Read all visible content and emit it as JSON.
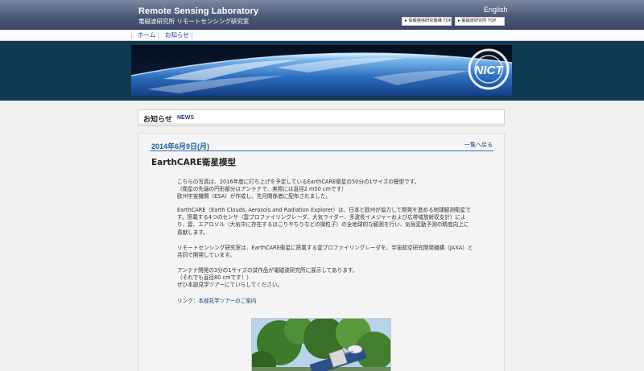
{
  "header": {
    "title": "Remote Sensing Laboratory",
    "subtitle": "電磁波研究所 リモートセンシング研究室",
    "language_link": "English",
    "buttons": [
      "▸ 情報通信研究機構 TOP",
      "▸ 電磁波研究所 TOP"
    ]
  },
  "nav": {
    "items": [
      "ホーム",
      "お知らせ"
    ]
  },
  "banner": {
    "logo_text": "NICT"
  },
  "section": {
    "title": "お知らせ",
    "subtitle": "NEWS"
  },
  "article": {
    "date": "2014年6月9日(月)",
    "back_link": "一覧へ戻る",
    "title": "EarthCARE衛星模型",
    "paragraphs": {
      "p1": [
        "こちらの写真は、2016年度に打ち上げを予定しているEarthCARE衛星の50分の1サイズの模型です。",
        "（衛星の先端の円形部分はアンテナで、実際には直径2 m50 cmです）",
        "欧州宇宙機関（ESA）が作成し、先月関係者に配布されました。"
      ],
      "p2": [
        "EarthCARE（Earth Clouds, Aerosols and Radiation Explorer）は、日本と欧州が協力して開発を進める地球観測衛星で",
        "す。搭載する4つのセンサ（雲プロファイリングレーダ、大気ライダー、多波長イメジャーおよび広帯域放射収支計）によ",
        "り、雲、エアロゾル（大気中に存在するほこりやちりなどの微粒子）の全地球的な観測を行い、気候変動予測の精度向上に",
        "貢献します。"
      ],
      "p3": [
        "リモートセンシング研究室は、EarthCARE衛星に搭載する雲プロファイリングレーダを、宇宙航空研究開発機構（JAXA）と",
        "共同で開発しています。"
      ],
      "p4": [
        "アンテナ開発の3分の1サイズの試作品が電磁波研究所に展示してあります。",
        "（それでも直径80 cmです！）",
        "ぜひ本部見学ツアーにていらしてください。"
      ],
      "link_prefix": "リンク：",
      "link_text": "本部見学ツアーのご案内"
    }
  },
  "colors": {
    "header": "#4a5877",
    "link": "#1d3e86",
    "date": "#1d5fa3",
    "banner_band": "#0f3a52"
  }
}
